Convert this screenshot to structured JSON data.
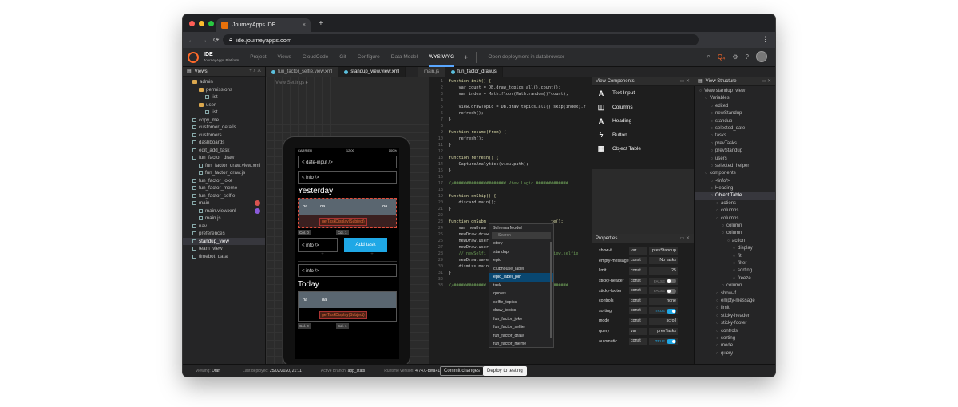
{
  "browser": {
    "tab_title": "JourneyApps IDE",
    "tab_close": "×",
    "new_tab": "+",
    "url": "ide.journeyapps.com",
    "back": "←",
    "forward": "→",
    "reload": "⟳",
    "menu": "⋮",
    "dots": [
      "#ff5f57",
      "#febc2e",
      "#28c840"
    ]
  },
  "appnav": {
    "title": "IDE",
    "subtitle": "JourneyApps Platform",
    "items": [
      "Project",
      "Views",
      "CloudCode",
      "Git",
      "Configure",
      "Data Model",
      "WYSIWYG"
    ],
    "plus": "+",
    "open_deployment": "Open deployment in databrowser"
  },
  "left_panel": {
    "title": "Views",
    "items": [
      {
        "label": "admin",
        "type": "folder",
        "indent": 1
      },
      {
        "label": "permissions",
        "type": "folder",
        "indent": 2
      },
      {
        "label": "list",
        "type": "file",
        "indent": 3
      },
      {
        "label": "user",
        "type": "folder",
        "indent": 2
      },
      {
        "label": "list",
        "type": "file",
        "indent": 3
      },
      {
        "label": "copy_me",
        "type": "file",
        "indent": 1
      },
      {
        "label": "customer_details",
        "type": "file",
        "indent": 1
      },
      {
        "label": "customers",
        "type": "file",
        "indent": 1
      },
      {
        "label": "dashboards",
        "type": "file",
        "indent": 1
      },
      {
        "label": "edit_add_task",
        "type": "file",
        "indent": 1
      },
      {
        "label": "fun_factor_draw",
        "type": "file",
        "indent": 1
      },
      {
        "label": "fun_factor_draw.view.xml",
        "type": "file",
        "indent": 2
      },
      {
        "label": "fun_factor_draw.js",
        "type": "file",
        "indent": 2
      },
      {
        "label": "fun_factor_joke",
        "type": "file",
        "indent": 1
      },
      {
        "label": "fun_factor_meme",
        "type": "file",
        "indent": 1
      },
      {
        "label": "fun_factor_selfie",
        "type": "file",
        "indent": 1
      },
      {
        "label": "main",
        "type": "file",
        "indent": 1
      },
      {
        "label": "main.view.xml",
        "type": "file",
        "indent": 2
      },
      {
        "label": "main.js",
        "type": "file",
        "indent": 2
      },
      {
        "label": "nav",
        "type": "file",
        "indent": 1
      },
      {
        "label": "preferences",
        "type": "file",
        "indent": 1
      },
      {
        "label": "standup_view",
        "type": "file",
        "indent": 1,
        "selected": true
      },
      {
        "label": "team_view",
        "type": "file",
        "indent": 1
      },
      {
        "label": "timebot_data",
        "type": "file",
        "indent": 1
      }
    ]
  },
  "editor_tabs": [
    {
      "label": "fun_factor_selfie.view.xml",
      "active": false
    },
    {
      "label": "standup_view.view.xml",
      "active": true
    },
    {
      "label": "main.js",
      "active": false
    },
    {
      "label": "fun_factor_draw.js",
      "active": false
    }
  ],
  "preview": {
    "view_settings": "View Settings",
    "status_carrier": "CARRIER",
    "status_time": "12:00",
    "status_battery": "100%",
    "date_input": "< date-input />",
    "info1": "< info />",
    "heading_yesterday": "Yesterday",
    "col_na": "na",
    "task_display": "getTaskDisplay(Subject)",
    "col0": "Col. 0",
    "col1": "Col. 1",
    "info2": "< info />",
    "add_task": "Add task",
    "info3": "< info />",
    "heading_today": "Today"
  },
  "code_lines": [
    {
      "n": "1",
      "t": "function init() {"
    },
    {
      "n": "2",
      "t": "    var count = DB.draw_topics.all().count();"
    },
    {
      "n": "3",
      "t": "    var index = Math.floor(Math.random()*count);"
    },
    {
      "n": "4",
      "t": ""
    },
    {
      "n": "5",
      "t": "    view.drawTopic = DB.draw_topics.all().skip(index).f"
    },
    {
      "n": "6",
      "t": "    refresh();"
    },
    {
      "n": "7",
      "t": "}"
    },
    {
      "n": "8",
      "t": ""
    },
    {
      "n": "9",
      "t": "function resume(from) {"
    },
    {
      "n": "10",
      "t": "    refresh();"
    },
    {
      "n": "11",
      "t": "}"
    },
    {
      "n": "12",
      "t": ""
    },
    {
      "n": "13",
      "t": "function refresh() {"
    },
    {
      "n": "14",
      "t": "    CaptureAnalytics(view.path);"
    },
    {
      "n": "15",
      "t": "}"
    },
    {
      "n": "16",
      "t": ""
    },
    {
      "n": "17",
      "t": "//##################### View Logic #############"
    },
    {
      "n": "18",
      "t": ""
    },
    {
      "n": "19",
      "t": "function onSkip() {"
    },
    {
      "n": "20",
      "t": "    discard.main();"
    },
    {
      "n": "21",
      "t": "}"
    },
    {
      "n": "22",
      "t": ""
    },
    {
      "n": "23",
      "t": "function onSubm                          te();"
    },
    {
      "n": "24",
      "t": "    var newDraw"
    },
    {
      "n": "25",
      "t": "    newDraw.draw"
    },
    {
      "n": "26",
      "t": "    newDraw.user"
    },
    {
      "n": "27",
      "t": "    newDraw.user"
    },
    {
      "n": "28",
      "t": "    // newSelfi                        = view.selfie"
    },
    {
      "n": "29",
      "t": "    newDraw.save"
    },
    {
      "n": "30",
      "t": "    dismiss.main"
    },
    {
      "n": "31",
      "t": "}"
    },
    {
      "n": "32",
      "t": ""
    },
    {
      "n": "33",
      "t": "//#############                      ###########"
    }
  ],
  "schema_popup": {
    "title": "Schema Model",
    "search_placeholder": "Search",
    "items": [
      "story",
      "standup",
      "epic",
      "clubhouse_label",
      "epic_label_join",
      "task",
      "quotes",
      "selfie_topics",
      "draw_topics",
      "fun_factor_joke",
      "fun_factor_selfie",
      "fun_factor_draw",
      "fun_factor_meme"
    ],
    "selected": "epic_label_join"
  },
  "view_components": {
    "title": "View Components",
    "items": [
      {
        "label": "Text Input",
        "icon": "A"
      },
      {
        "label": "Columns",
        "icon": "◫"
      },
      {
        "label": "Heading",
        "icon": "A"
      },
      {
        "label": "Button",
        "icon": "ϟ"
      },
      {
        "label": "Object Table",
        "icon": "▦"
      }
    ]
  },
  "properties": {
    "title": "Properties",
    "rows": [
      {
        "key": "show-if",
        "type": "var",
        "value": "prevStandup"
      },
      {
        "key": "empty-message",
        "type": "const",
        "value": "No tasks"
      },
      {
        "key": "limit",
        "type": "const",
        "value": "25"
      },
      {
        "key": "sticky-header",
        "type": "const",
        "value": "FALSE",
        "toggle": "off"
      },
      {
        "key": "sticky-footer",
        "type": "const",
        "value": "FALSE",
        "toggle": "off"
      },
      {
        "key": "controls",
        "type": "const",
        "value": "none"
      },
      {
        "key": "sorting",
        "type": "const",
        "value": "TRUE",
        "toggle": "on"
      },
      {
        "key": "mode",
        "type": "const",
        "value": "scroll"
      },
      {
        "key": "query",
        "type": "var",
        "value": "prevTasks"
      },
      {
        "key": "automatic",
        "type": "const",
        "value": "TRUE",
        "toggle": "on"
      }
    ]
  },
  "view_structure": {
    "title": "View Structure",
    "items": [
      {
        "label": "View:standup_view",
        "indent": 0
      },
      {
        "label": "Variables",
        "indent": 1
      },
      {
        "label": "edited",
        "indent": 2
      },
      {
        "label": "newStandup",
        "indent": 2
      },
      {
        "label": "standup",
        "indent": 2
      },
      {
        "label": "selected_date",
        "indent": 2
      },
      {
        "label": "tasks",
        "indent": 2
      },
      {
        "label": "prevTasks",
        "indent": 2
      },
      {
        "label": "prevStandup",
        "indent": 2
      },
      {
        "label": "users",
        "indent": 2
      },
      {
        "label": "selected_helper",
        "indent": 2
      },
      {
        "label": "components",
        "indent": 1
      },
      {
        "label": "<info/>",
        "indent": 2
      },
      {
        "label": "Heading",
        "indent": 2
      },
      {
        "label": "Object Table",
        "indent": 2,
        "selected": true
      },
      {
        "label": "actions",
        "indent": 3
      },
      {
        "label": "columns",
        "indent": 3
      },
      {
        "label": "columns",
        "indent": 3
      },
      {
        "label": "column",
        "indent": 4
      },
      {
        "label": "column",
        "indent": 4
      },
      {
        "label": "action",
        "indent": 5
      },
      {
        "label": "display",
        "indent": 6
      },
      {
        "label": "fit",
        "indent": 6
      },
      {
        "label": "filter",
        "indent": 6
      },
      {
        "label": "sorting",
        "indent": 6
      },
      {
        "label": "freeze",
        "indent": 6
      },
      {
        "label": "column",
        "indent": 4
      },
      {
        "label": "show-if",
        "indent": 3
      },
      {
        "label": "empty-message",
        "indent": 3
      },
      {
        "label": "limit",
        "indent": 3
      },
      {
        "label": "sticky-header",
        "indent": 3
      },
      {
        "label": "sticky-footer",
        "indent": 3
      },
      {
        "label": "controls",
        "indent": 3
      },
      {
        "label": "sorting",
        "indent": 3
      },
      {
        "label": "mode",
        "indent": 3
      },
      {
        "label": "query",
        "indent": 3
      }
    ]
  },
  "bottom": {
    "viewing_label": "Viewing:",
    "viewing_value": "Draft",
    "deployed_label": "Last deployed:",
    "deployed_value": "25/02/2020, 21:11",
    "branch_label": "Active Branch:",
    "branch_value": "app_stats",
    "runtime_label": "Runtime version:",
    "runtime_value": "4.74.0-beta+1",
    "commit": "Commit changes",
    "deploy": "Deploy to testing"
  }
}
